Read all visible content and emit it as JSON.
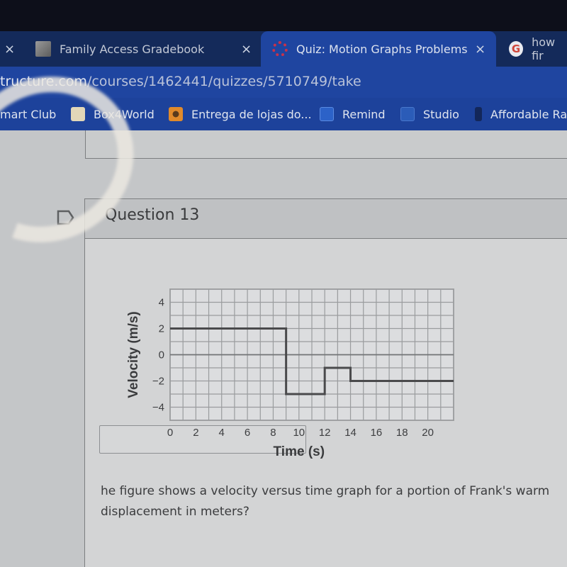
{
  "browser": {
    "tabs": [
      {
        "label": "",
        "icon": "close-icon",
        "partial": true
      },
      {
        "label": "Family Access Gradebook",
        "icon": "family-access-icon",
        "active": false
      },
      {
        "label": "Quiz: Motion Graphs Problems",
        "icon": "canvas-quiz-icon",
        "active": true
      },
      {
        "label": "how fir",
        "icon": "google-icon",
        "active": false
      }
    ],
    "tab_close_glyph": "×",
    "google_glyph": "G",
    "url": {
      "host": "tructure.com",
      "path": "/courses/1462441/quizzes/5710749/take"
    },
    "bookmarks": [
      {
        "label": "mart Club",
        "icon": "none"
      },
      {
        "label": "Box4World",
        "icon": "box4world-icon"
      },
      {
        "label": "Entrega de lojas do...",
        "icon": "entrega-icon"
      },
      {
        "label": "Remind",
        "icon": "remind-icon"
      },
      {
        "label": "Studio",
        "icon": "studio-icon"
      },
      {
        "label": "Affordable Ra",
        "icon": "bookmark-icon"
      }
    ]
  },
  "question": {
    "title": "Question 13",
    "text_line1": "he figure shows a velocity versus time graph for a portion of Frank's warm",
    "text_line2": "displacement in meters?",
    "answer_value": ""
  },
  "chart_data": {
    "type": "line",
    "title": "",
    "xlabel": "Time (s)",
    "ylabel": "Velocity (m/s)",
    "xlim": [
      0,
      22
    ],
    "ylim": [
      -5,
      5
    ],
    "x_ticks": [
      0,
      2,
      4,
      6,
      8,
      10,
      12,
      14,
      16,
      18,
      20
    ],
    "y_ticks": [
      4,
      2,
      0,
      -2,
      -4
    ],
    "grid": true,
    "grid_step_x": 1,
    "grid_step_y": 1,
    "series": [
      {
        "name": "velocity",
        "step": true,
        "x": [
          0,
          9,
          9,
          12,
          12,
          14,
          14,
          22
        ],
        "y": [
          2,
          2,
          -3,
          -3,
          -1,
          -1,
          -2,
          -2
        ]
      }
    ],
    "colors": {
      "line": "#4a4a4c",
      "grid": "#9a9c9e",
      "axis": "#7c7e80"
    }
  }
}
